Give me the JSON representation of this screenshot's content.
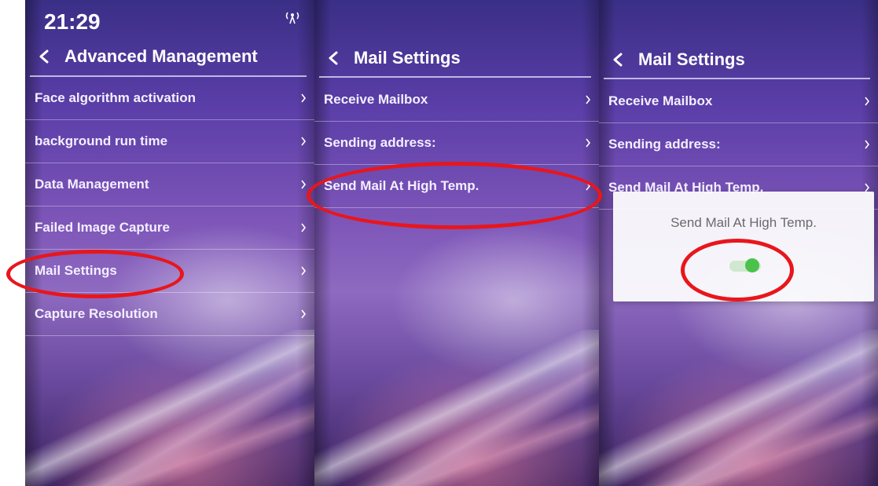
{
  "panels": [
    {
      "status": {
        "time": "21:29",
        "icon": "signal-tower-icon"
      },
      "title": "Advanced Management",
      "items": [
        {
          "label": "Face algorithm activation"
        },
        {
          "label": "background run time"
        },
        {
          "label": "Data Management"
        },
        {
          "label": "Failed Image Capture"
        },
        {
          "label": "Mail Settings"
        },
        {
          "label": "Capture Resolution"
        }
      ]
    },
    {
      "title": "Mail Settings",
      "items": [
        {
          "label": "Receive Mailbox"
        },
        {
          "label": "Sending address:"
        },
        {
          "label": "Send Mail At High Temp."
        }
      ]
    },
    {
      "title": "Mail Settings",
      "items": [
        {
          "label": "Receive Mailbox"
        },
        {
          "label": "Sending address:"
        },
        {
          "label": "Send Mail At High Temp."
        }
      ],
      "dialog": {
        "title": "Send Mail At High Temp.",
        "toggle_on": true
      }
    }
  ],
  "colors": {
    "annotation": "#e8161c",
    "toggle_on": "#4cc24c"
  }
}
